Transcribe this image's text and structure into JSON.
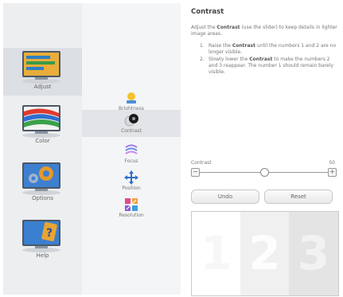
{
  "categories": [
    {
      "label": "Adjust",
      "icon": "adjust-monitor-icon",
      "active": true
    },
    {
      "label": "Color",
      "icon": "color-monitor-icon",
      "active": false
    },
    {
      "label": "Options",
      "icon": "options-monitor-icon",
      "active": false
    },
    {
      "label": "Help",
      "icon": "help-monitor-icon",
      "active": false
    }
  ],
  "subitems": [
    {
      "label": "Brightness",
      "icon": "brightness-icon",
      "active": false
    },
    {
      "label": "Contrast",
      "icon": "contrast-icon",
      "active": true
    },
    {
      "label": "Focus",
      "icon": "focus-icon",
      "active": false
    },
    {
      "label": "Position",
      "icon": "position-icon",
      "active": false
    },
    {
      "label": "Resolution",
      "icon": "resolution-icon",
      "active": false
    }
  ],
  "content": {
    "title": "Contrast",
    "intro_parts": [
      "Adjust the ",
      "Contrast",
      " (use the slider) to keep details in lighter image areas."
    ],
    "steps": [
      {
        "num": "1.",
        "parts": [
          "Raise the ",
          "Contrast",
          " until the numbers 1 and 2 are no longer visible."
        ]
      },
      {
        "num": "2.",
        "parts": [
          "Slowly lower the ",
          "Contrast",
          " to make the numbers 2 and 3 reappear. The number 1 should remain barely visible."
        ]
      }
    ],
    "slider": {
      "label": "Contrast",
      "value": 50,
      "min": 0,
      "max": 100,
      "minus": "−",
      "plus": "+"
    },
    "buttons": {
      "undo": "Undo",
      "reset": "Reset"
    },
    "test_pattern": [
      "1",
      "2",
      "3"
    ]
  },
  "colors": {
    "panel_bg": "#eceef0",
    "active_bg": "#dcdfe3",
    "sub_bg": "#f4f5f6"
  }
}
